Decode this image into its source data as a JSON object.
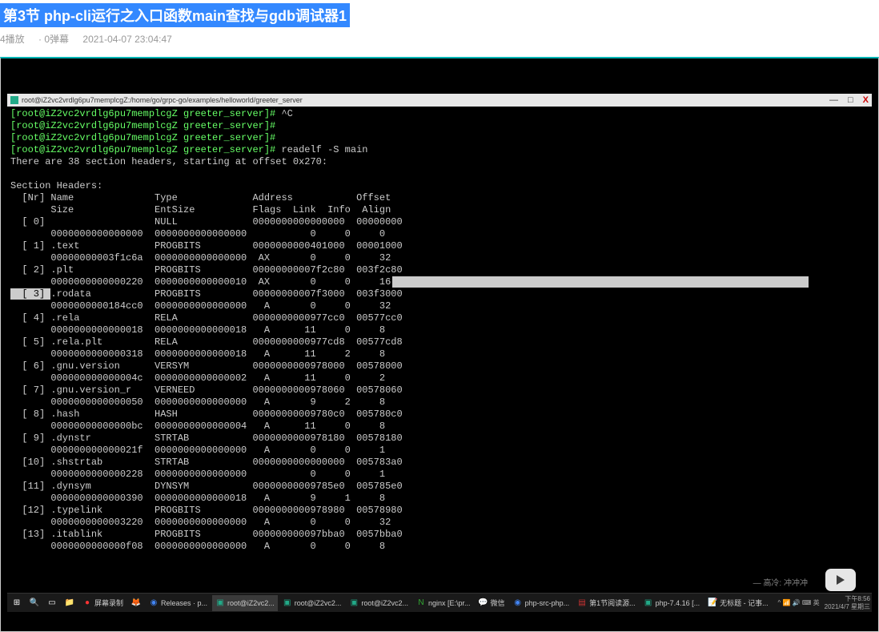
{
  "header": {
    "title": "第3节 php-cli运行之入口函数main查找与gdb调试器1",
    "plays": "4播放",
    "danmaku": "0弹幕",
    "timestamp": "2021-04-07 23:04:47"
  },
  "window": {
    "title": "root@iZ2vc2vrdlg6pu7memplcgZ:/home/go/grpc-go/examples/helloworld/greeter_server",
    "minimize": "—",
    "maximize": "□",
    "close": "X"
  },
  "terminal": {
    "prompt": "[root@iZ2vc2vrdlg6pu7memplcgZ greeter_server]#",
    "cmd_interrupt": " ^C",
    "cmd_readelf": " readelf -S main",
    "info_line": "There are 38 section headers, starting at offset 0x270:",
    "section_header": "Section Headers:",
    "hdr1": "  [Nr] Name              Type             Address           Offset",
    "hdr2": "       Size              EntSize          Flags  Link  Info  Align",
    "rows": [
      "  [ 0]                   NULL             0000000000000000  00000000",
      "       0000000000000000  0000000000000000           0     0     0",
      "  [ 1] .text             PROGBITS         0000000000401000  00001000",
      "       00000000003f1c6a  0000000000000000  AX       0     0     32",
      "  [ 2] .plt              PROGBITS         00000000007f2c80  003f2c80",
      "       0000000000000220  0000000000000010  AX       0     0     16",
      "  [ 3] .rodata           PROGBITS         00000000007f3000  003f3000",
      "       0000000000184cc0  0000000000000000   A       0     0     32",
      "  [ 4] .rela             RELA             0000000000977cc0  00577cc0",
      "       0000000000000018  0000000000000018   A      11     0     8",
      "  [ 5] .rela.plt         RELA             0000000000977cd8  00577cd8",
      "       0000000000000318  0000000000000018   A      11     2     8",
      "  [ 6] .gnu.version      VERSYM           0000000000978000  00578000",
      "       000000000000004c  0000000000000002   A      11     0     2",
      "  [ 7] .gnu.version_r    VERNEED          0000000000978060  00578060",
      "       0000000000000050  0000000000000000   A       9     2     8",
      "  [ 8] .hash             HASH             00000000009780c0  005780c0",
      "       00000000000000bc  0000000000000004   A      11     0     8",
      "  [ 9] .dynstr           STRTAB           0000000000978180  00578180",
      "       000000000000021f  0000000000000000   A       0     0     1",
      "  [10] .shstrtab         STRTAB           0000000000000000  005783a0",
      "       0000000000000228  0000000000000000           0     0     1",
      "  [11] .dynsym           DYNSYM           00000000009785e0  005785e0",
      "       0000000000000390  0000000000000018   A       9     1     8",
      "  [12] .typelink         PROGBITS         0000000000978980  00578980",
      "       0000000000003220  0000000000000000   A       0     0     32",
      "  [13] .itablink         PROGBITS         000000000097bba0  0057bba0",
      "       0000000000000f08  0000000000000000   A       0     0     8"
    ]
  },
  "subtitle": "高冷: 冲冲冲",
  "taskbar": {
    "items": [
      {
        "icon": "⊞",
        "label": "",
        "color": "#fff"
      },
      {
        "icon": "🔍",
        "label": "",
        "color": "#fff"
      },
      {
        "icon": "▭",
        "label": "",
        "color": "#fff"
      },
      {
        "icon": "📁",
        "label": "",
        "color": "#ffcc66"
      },
      {
        "icon": "●",
        "label": "屏幕录制",
        "color": "#f33"
      },
      {
        "icon": "🦊",
        "label": "",
        "color": "#ff7b00"
      },
      {
        "icon": "◉",
        "label": "Releases · p...",
        "color": "#4285f4"
      },
      {
        "icon": "▣",
        "label": "root@iZ2vc2...",
        "color": "#2a8",
        "active": true
      },
      {
        "icon": "▣",
        "label": "root@iZ2vc2...",
        "color": "#2a8"
      },
      {
        "icon": "▣",
        "label": "root@iZ2vc2...",
        "color": "#2a8"
      },
      {
        "icon": "N",
        "label": "nginx [E:\\pr...",
        "color": "#3a3"
      },
      {
        "icon": "💬",
        "label": "微信",
        "color": "#3c3"
      },
      {
        "icon": "◉",
        "label": "php-src-php...",
        "color": "#4285f4"
      },
      {
        "icon": "▤",
        "label": "第1节阅读源...",
        "color": "#c33"
      },
      {
        "icon": "▣",
        "label": "php-7.4.16 [...",
        "color": "#2a8"
      },
      {
        "icon": "📝",
        "label": "无标题 - 记事...",
        "color": "#5bf"
      }
    ],
    "tray_icons": "^ 📶 🔊 ⌨ 英",
    "clock_time": "下午8:56",
    "clock_date": "2021/4/7 星期三"
  }
}
